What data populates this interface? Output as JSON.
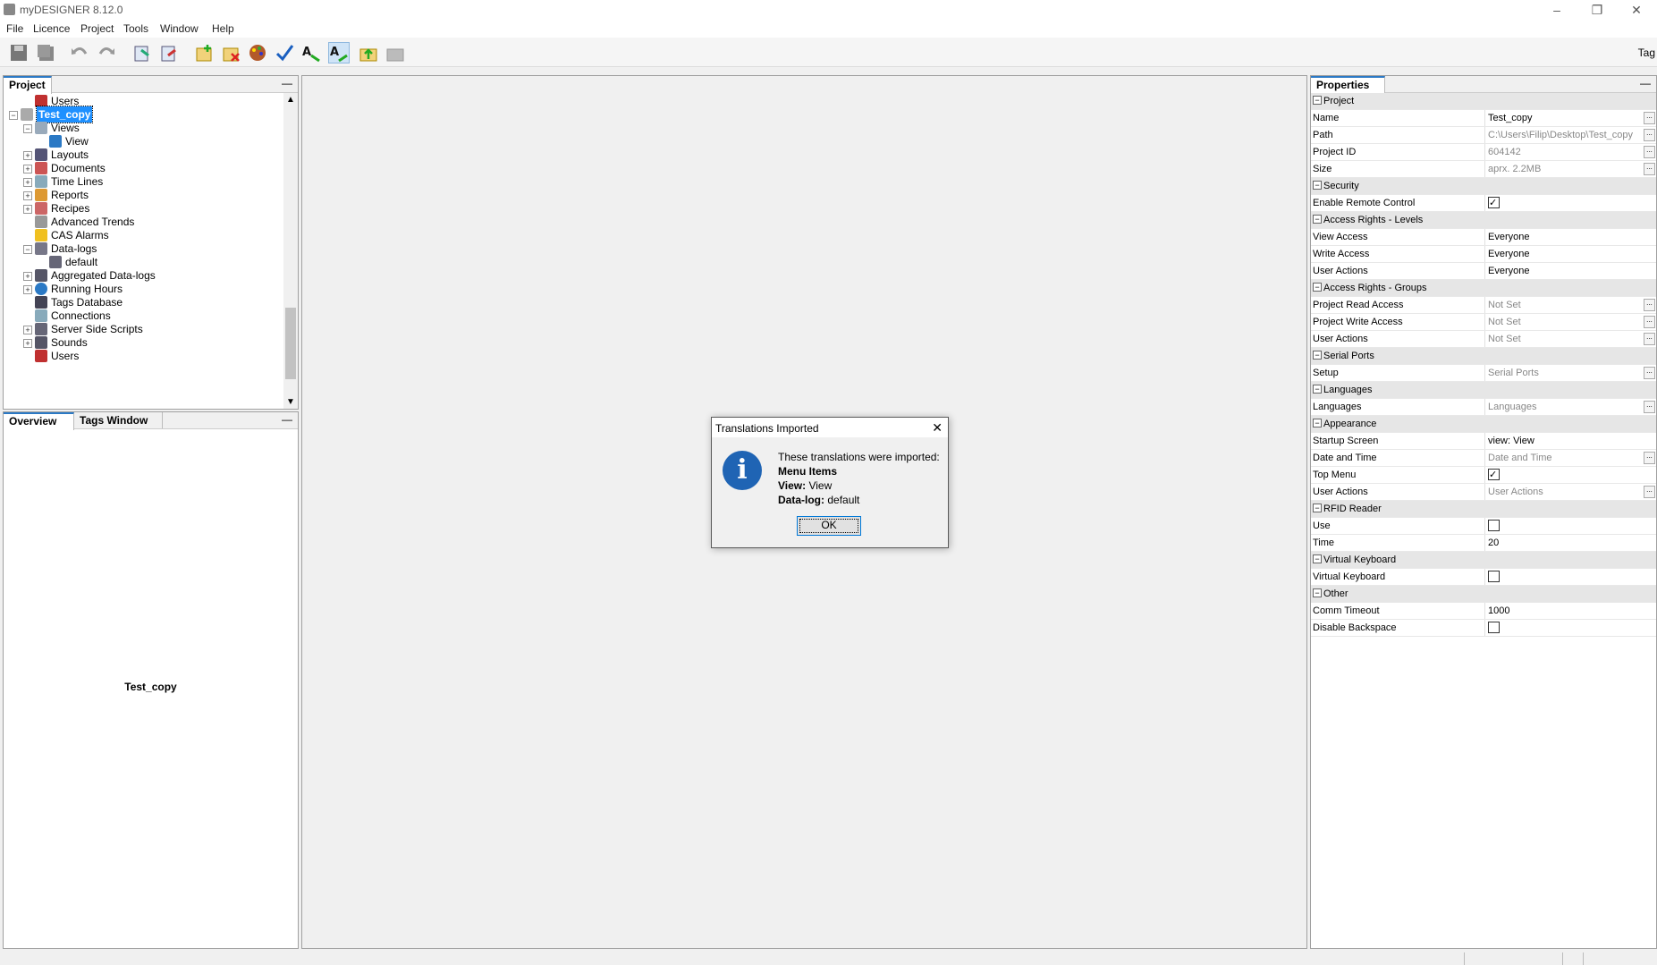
{
  "window": {
    "title": "myDESIGNER 8.12.0",
    "minimize": "–",
    "restore": "❐",
    "close": "✕"
  },
  "menu": [
    "File",
    "Licence",
    "Project",
    "Tools",
    "Window",
    "Help"
  ],
  "toolbar": {
    "tag_label": "Tag"
  },
  "project_panel": {
    "tab": "Project",
    "minimize": "—",
    "tree": [
      {
        "label": "Users",
        "icon": "users-icon"
      },
      {
        "label": "Test_copy",
        "icon": "project-icon",
        "selected": true
      },
      {
        "label": "Views",
        "icon": "views-icon"
      },
      {
        "label": "View",
        "icon": "view-icon"
      },
      {
        "label": "Layouts",
        "icon": "layouts-icon"
      },
      {
        "label": "Documents",
        "icon": "documents-icon"
      },
      {
        "label": "Time Lines",
        "icon": "timelines-icon"
      },
      {
        "label": "Reports",
        "icon": "reports-icon"
      },
      {
        "label": "Recipes",
        "icon": "recipes-icon"
      },
      {
        "label": "Advanced Trends",
        "icon": "trends-icon"
      },
      {
        "label": "CAS Alarms",
        "icon": "alarm-icon"
      },
      {
        "label": "Data-logs",
        "icon": "datalogs-icon"
      },
      {
        "label": "default",
        "icon": "datalog-icon"
      },
      {
        "label": "Aggregated Data-logs",
        "icon": "aggregated-icon"
      },
      {
        "label": "Running Hours",
        "icon": "clock-icon"
      },
      {
        "label": "Tags Database",
        "icon": "database-icon"
      },
      {
        "label": "Connections",
        "icon": "connections-icon"
      },
      {
        "label": "Server Side Scripts",
        "icon": "scripts-icon"
      },
      {
        "label": "Sounds",
        "icon": "sounds-icon"
      },
      {
        "label": "Users",
        "icon": "users-icon"
      }
    ]
  },
  "overview_panel": {
    "tabs": [
      "Overview",
      "Tags Window"
    ],
    "minimize": "—",
    "content": "Test_copy"
  },
  "properties_panel": {
    "tab": "Properties",
    "minimize": "—",
    "rows": [
      {
        "type": "cat",
        "name": "Project"
      },
      {
        "name": "Name",
        "value": "Test_copy",
        "btn": true
      },
      {
        "name": "Path",
        "value": "C:\\Users\\Filip\\Desktop\\Test_copy",
        "gray": true,
        "btn": true
      },
      {
        "name": "Project ID",
        "value": "604142",
        "gray": true,
        "btn": true
      },
      {
        "name": "Size",
        "value": "aprx. 2.2MB",
        "gray": true,
        "btn": true
      },
      {
        "type": "cat",
        "name": "Security"
      },
      {
        "name": "Enable Remote Control",
        "check": true
      },
      {
        "type": "cat",
        "name": "Access Rights - Levels"
      },
      {
        "name": "View Access",
        "value": "Everyone"
      },
      {
        "name": "Write Access",
        "value": "Everyone"
      },
      {
        "name": "User Actions",
        "value": "Everyone"
      },
      {
        "type": "cat",
        "name": "Access Rights - Groups"
      },
      {
        "name": "Project Read Access",
        "value": "Not Set",
        "gray": true,
        "btn": true
      },
      {
        "name": "Project Write Access",
        "value": "Not Set",
        "gray": true,
        "btn": true
      },
      {
        "name": "User Actions",
        "value": "Not Set",
        "gray": true,
        "btn": true
      },
      {
        "type": "cat",
        "name": "Serial Ports"
      },
      {
        "name": "Setup",
        "value": "Serial Ports",
        "gray": true,
        "btn": true
      },
      {
        "type": "cat",
        "name": "Languages"
      },
      {
        "name": "Languages",
        "value": "Languages",
        "gray": true,
        "btn": true
      },
      {
        "type": "cat",
        "name": "Appearance"
      },
      {
        "name": "Startup Screen",
        "value": "view: View"
      },
      {
        "name": "Date and Time",
        "value": "Date and Time",
        "gray": true,
        "btn": true
      },
      {
        "name": "Top Menu",
        "check": true
      },
      {
        "name": "User Actions",
        "value": "User Actions",
        "gray": true,
        "btn": true
      },
      {
        "type": "cat",
        "name": "RFID Reader"
      },
      {
        "name": "Use",
        "check": false
      },
      {
        "name": "Time",
        "value": "20"
      },
      {
        "type": "cat",
        "name": "Virtual Keyboard"
      },
      {
        "name": "Virtual Keyboard",
        "check": false
      },
      {
        "type": "cat",
        "name": "Other"
      },
      {
        "name": "Comm Timeout",
        "value": "1000"
      },
      {
        "name": "Disable Backspace",
        "check": false
      }
    ]
  },
  "dialog": {
    "title": "Translations Imported",
    "close": "✕",
    "icon": "i",
    "intro": "These translations were imported:",
    "line1": "Menu Items",
    "line2_label": "View:",
    "line2_value": "View",
    "line3_label": "Data-log:",
    "line3_value": "default",
    "ok": "OK"
  },
  "colors": {
    "accent": "#2b79c5",
    "selection": "#1e90ff",
    "dialog_icon": "#1f64b4"
  }
}
